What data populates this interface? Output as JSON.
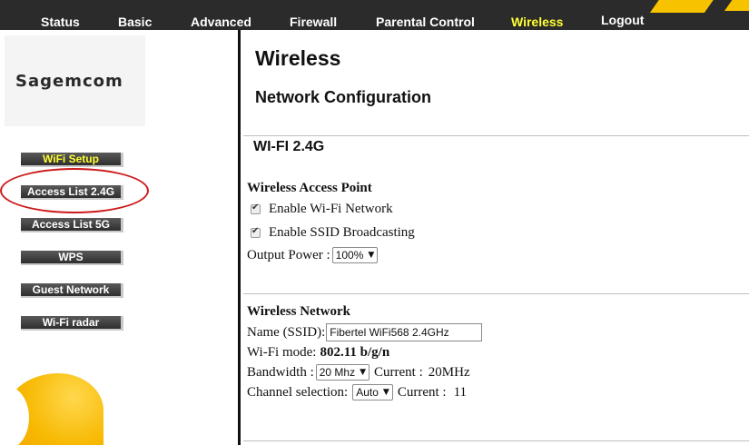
{
  "nav": {
    "items": [
      {
        "label": "Status"
      },
      {
        "label": "Basic"
      },
      {
        "label": "Advanced"
      },
      {
        "label": "Firewall"
      },
      {
        "label": "Parental Control"
      },
      {
        "label": "Wireless",
        "active": true
      },
      {
        "label": "Logout"
      }
    ],
    "accent_color": "#ffff33",
    "brand_color": "#f7c300"
  },
  "sidebar": {
    "logo": "Sagemcom",
    "items": [
      {
        "label": "WiFi Setup",
        "active": true
      },
      {
        "label": "Access List 2.4G",
        "highlighted": true
      },
      {
        "label": "Access List 5G"
      },
      {
        "label": "WPS"
      },
      {
        "label": "Guest Network"
      },
      {
        "label": "Wi-Fi radar"
      }
    ]
  },
  "main": {
    "title": "Wireless",
    "section": "Network Configuration",
    "band": "WI-FI 2.4G",
    "access_point": {
      "title": "Wireless Access Point",
      "enable_wifi_label": "Enable Wi-Fi Network",
      "enable_wifi_checked": true,
      "enable_ssid_label": "Enable SSID Broadcasting",
      "enable_ssid_checked": true,
      "output_power_label": "Output Power :",
      "output_power_value": "100%"
    },
    "network": {
      "title": "Wireless Network",
      "ssid_label": "Name (SSID):",
      "ssid_value": "Fibertel WiFi568 2.4GHz",
      "mode_label": "Wi-Fi mode:",
      "mode_value": "802.11 b/g/n",
      "bandwidth_label": "Bandwidth :",
      "bandwidth_value": "20 Mhz",
      "bandwidth_current_label": "Current :",
      "bandwidth_current_value": "20MHz",
      "channel_label": "Channel selection:",
      "channel_value": "Auto",
      "channel_current_label": "Current :",
      "channel_current_value": "11"
    }
  }
}
